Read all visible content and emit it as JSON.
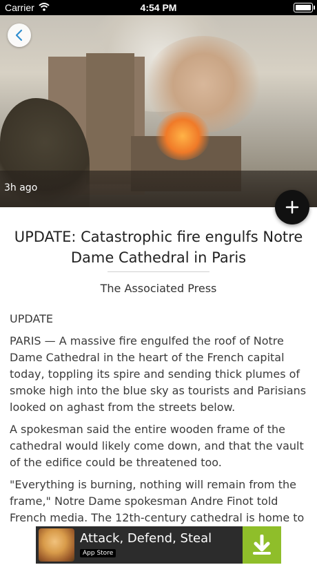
{
  "status_bar": {
    "carrier": "Carrier",
    "time": "4:54 PM"
  },
  "hero": {
    "timestamp": "3h ago"
  },
  "article": {
    "headline": "UPDATE: Catastrophic fire engulfs Notre Dame Cathedral in Paris",
    "source": "The Associated Press",
    "paragraphs": [
      "UPDATE",
      "PARIS — A massive fire engulfed the roof of Notre Dame Cathedral in the heart of the French capital today, toppling its spire and sending thick plumes of smoke high into the blue sky as tourists and Parisians looked on aghast from the streets below.",
      "A spokesman said the entire wooden frame of the cathedral would likely come down, and that the vault of the edifice could be threatened too.",
      "\"Everything is burning, nothing will remain from the frame,\" Notre Dame spokesman Andre Finot told French media. The 12th-century cathedral is home to"
    ]
  },
  "ad": {
    "title": "Attack, Defend, Steal",
    "store_label": "App Store"
  },
  "icons": {
    "back": "chevron-left-icon",
    "add": "plus-icon",
    "wifi": "wifi-icon",
    "battery": "battery-icon",
    "download": "download-icon"
  },
  "colors": {
    "accent": "#2f8ecf",
    "ad_green": "#8fbe2a"
  }
}
